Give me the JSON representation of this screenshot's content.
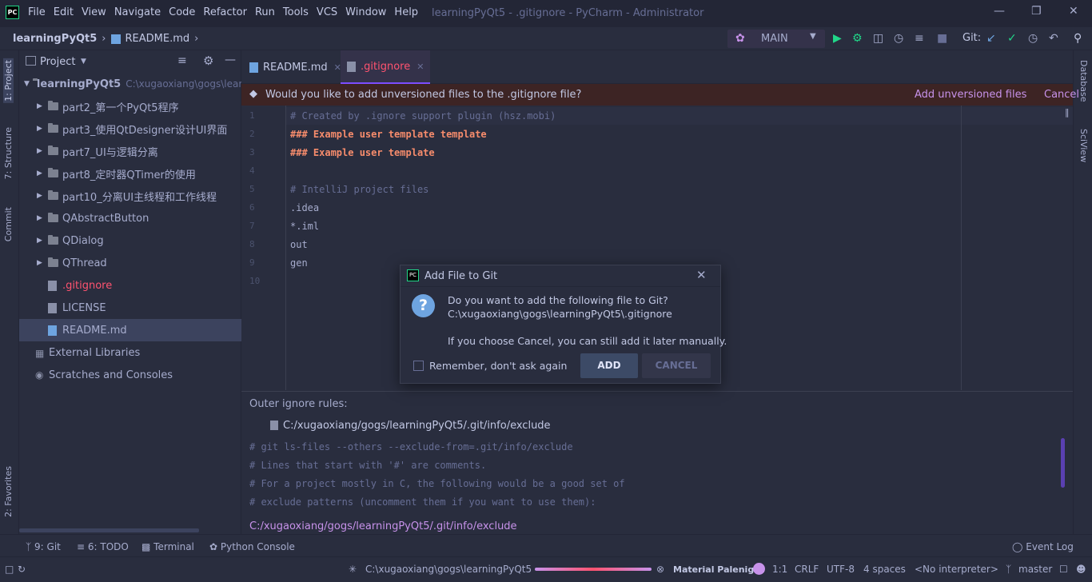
{
  "menu": [
    "File",
    "Edit",
    "View",
    "Navigate",
    "Code",
    "Refactor",
    "Run",
    "Tools",
    "VCS",
    "Window",
    "Help"
  ],
  "window_title": "learningPyQt5 - .gitignore - PyCharm - Administrator",
  "app_logo": "PC",
  "breadcrumbs": [
    "learningPyQt5",
    "README.md"
  ],
  "run_config": "MAIN",
  "git_label": "Git:",
  "left_stripe": [
    "1: Project",
    "7: Structure",
    "Commit",
    "2: Favorites"
  ],
  "right_stripe": [
    "Database",
    "SciView"
  ],
  "project": {
    "title": "Project",
    "root": {
      "label": "learningPyQt5",
      "path": "C:\\xugaoxiang\\gogs\\lear"
    },
    "items": [
      {
        "label": "part2_第一个PyQt5程序",
        "type": "folder"
      },
      {
        "label": "part3_使用QtDesigner设计UI界面",
        "type": "folder"
      },
      {
        "label": "part7_UI与逻辑分离",
        "type": "folder"
      },
      {
        "label": "part8_定时器QTimer的使用",
        "type": "folder"
      },
      {
        "label": "part10_分离UI主线程和工作线程",
        "type": "folder"
      },
      {
        "label": "QAbstractButton",
        "type": "folder"
      },
      {
        "label": "QDialog",
        "type": "folder"
      },
      {
        "label": "QThread",
        "type": "folder"
      },
      {
        "label": ".gitignore",
        "type": "file"
      },
      {
        "label": "LICENSE",
        "type": "file"
      },
      {
        "label": "README.md",
        "type": "file"
      }
    ],
    "external": "External Libraries",
    "scratches": "Scratches and Consoles"
  },
  "tabs": [
    {
      "label": "README.md"
    },
    {
      "label": ".gitignore"
    }
  ],
  "banner": {
    "text": "Would you like to add unversioned files to the .gitignore file?",
    "add": "Add unversioned files",
    "cancel": "Cancel"
  },
  "code": {
    "line_numbers": [
      "1",
      "2",
      "3",
      "4",
      "5",
      "6",
      "7",
      "8",
      "9",
      "10"
    ],
    "lines": [
      "# Created by .ignore support plugin (hsz.mobi)",
      "### Example user template template",
      "### Example user template",
      "",
      "# IntelliJ project files",
      ".idea",
      "*.iml",
      "out",
      "gen",
      ""
    ]
  },
  "outer": {
    "label": "Outer ignore rules:",
    "path": "C:/xugaoxiang/gogs/learningPyQt5/.git/info/exclude",
    "lines": [
      "# git ls-files --others --exclude-from=.git/info/exclude",
      "# Lines that start with '#' are comments.",
      "# For a project mostly in C, the following would be a good set of",
      "# exclude patterns (uncomment them if you want to use them):"
    ],
    "link": "C:/xugaoxiang/gogs/learningPyQt5/.git/info/exclude"
  },
  "bottom_tools": [
    "9: Git",
    "6: TODO",
    "Terminal",
    "Python Console",
    "Event Log"
  ],
  "status": {
    "task": "C:\\xugaoxiang\\gogs\\learningPyQt5",
    "theme": "Material Palenight",
    "position": "1:1",
    "line_sep": "CRLF",
    "encoding": "UTF-8",
    "indent": "4 spaces",
    "interpreter": "<No interpreter>",
    "branch": "master"
  },
  "dialog": {
    "title": "Add File to Git",
    "line1": "Do you want to add the following file to Git?",
    "line2": "C:\\xugaoxiang\\gogs\\learningPyQt5\\.gitignore",
    "line3": "If you choose Cancel, you can still add it later manually.",
    "checkbox": "Remember, don't ask again",
    "add": "ADD",
    "cancel": "CANCEL"
  },
  "colors": {
    "bg": "#292d3e",
    "accent": "#c792ea",
    "active_tab": "#ff5370",
    "header_code": "#f78c6c"
  }
}
